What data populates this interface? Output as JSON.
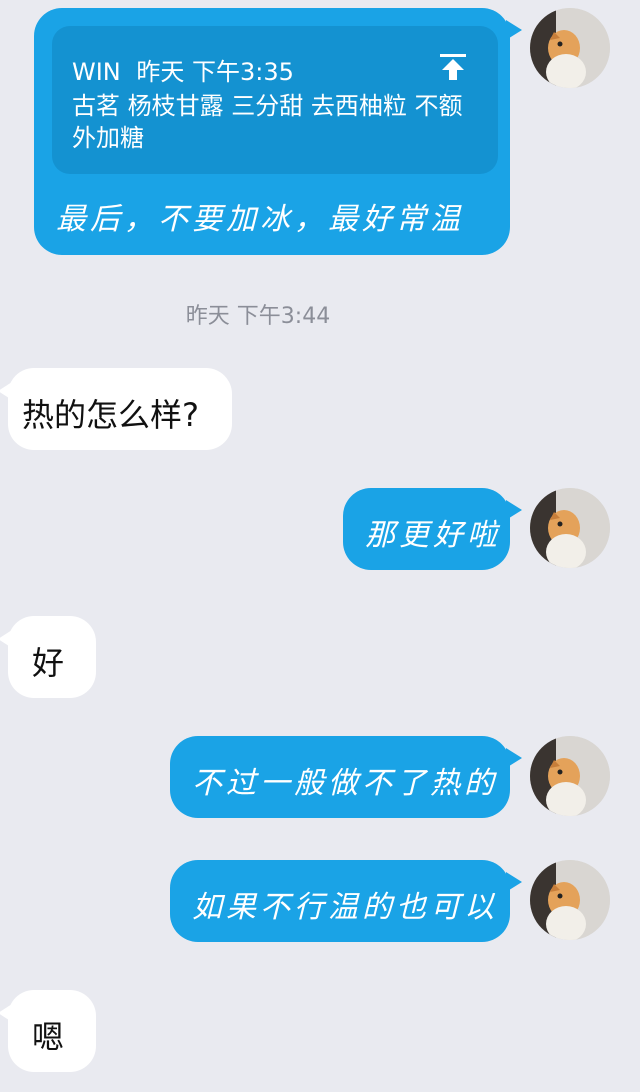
{
  "messages": {
    "quoted": {
      "sender": "WIN",
      "time": "昨天 下午3:35",
      "text": "古茗 杨枝甘露 三分甜 去西柚粒 不额外加糖",
      "reply": "最后，不要加冰，最好常温"
    },
    "timestamp": "昨天 下午3:44",
    "in1": "热的怎么样?",
    "out1": "那更好啦",
    "in2": "好",
    "out2": "不过一般做不了热的",
    "out3": "如果不行温的也可以",
    "in3": "嗯"
  },
  "colors": {
    "background": "#e9eaf0",
    "outgoing_bubble": "#1aa3e6",
    "quote_box": "#1492d1",
    "incoming_bubble": "#ffffff",
    "timestamp_text": "#8b8e98"
  },
  "icons": {
    "quote_pin": "pin-up-icon",
    "avatar": "cat-avatar"
  }
}
